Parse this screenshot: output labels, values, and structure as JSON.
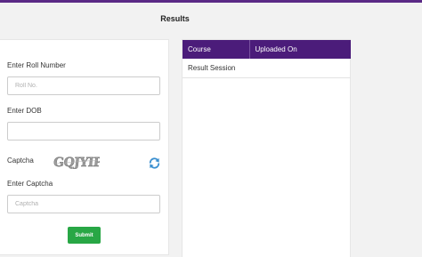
{
  "header": {
    "title": "Results"
  },
  "form": {
    "roll_label": "Enter Roll Number",
    "roll_placeholder": "Roll No.",
    "roll_value": "",
    "dob_label": "Enter DOB",
    "dob_value": "",
    "captcha_label": "Captcha",
    "captcha_text": "GQJYIP",
    "refresh_icon": "refresh-icon",
    "enter_captcha_label": "Enter Captcha",
    "captcha_placeholder": "Captcha",
    "captcha_value": "",
    "submit_label": "Submit",
    "submit_color": "#28a745"
  },
  "results_table": {
    "header_color": "#4b1c7a",
    "columns": [
      "Course",
      "Uploaded On"
    ],
    "rows": [
      [
        "Result Session",
        ""
      ]
    ]
  }
}
